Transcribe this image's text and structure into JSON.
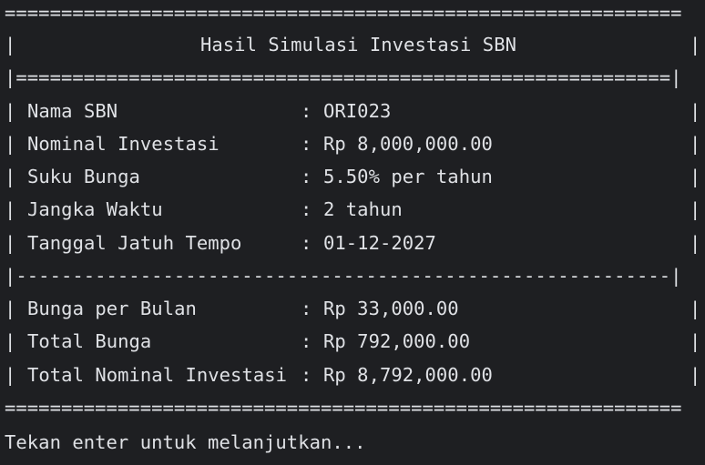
{
  "rules": {
    "top": "============================================================",
    "title_divider": "|==========================================================|",
    "mid_divider": "|----------------------------------------------------------|",
    "bottom": "============================================================"
  },
  "title": {
    "bar": "|",
    "text": "Hasil Simulasi Investasi SBN"
  },
  "bar": "|",
  "separator": ":",
  "details": [
    {
      "label": "Nama SBN",
      "value": "ORI023"
    },
    {
      "label": "Nominal Investasi",
      "value": "Rp 8,000,000.00"
    },
    {
      "label": "Suku Bunga",
      "value": "5.50% per tahun"
    },
    {
      "label": "Jangka Waktu",
      "value": "2 tahun"
    },
    {
      "label": "Tanggal Jatuh Tempo",
      "value": "01-12-2027"
    }
  ],
  "results": [
    {
      "label": "Bunga per Bulan",
      "value": "Rp 33,000.00"
    },
    {
      "label": "Total Bunga",
      "value": "Rp 792,000.00"
    },
    {
      "label": "Total Nominal Investasi",
      "value": "Rp 8,792,000.00"
    }
  ],
  "prompt": "Tekan enter untuk melanjutkan..."
}
